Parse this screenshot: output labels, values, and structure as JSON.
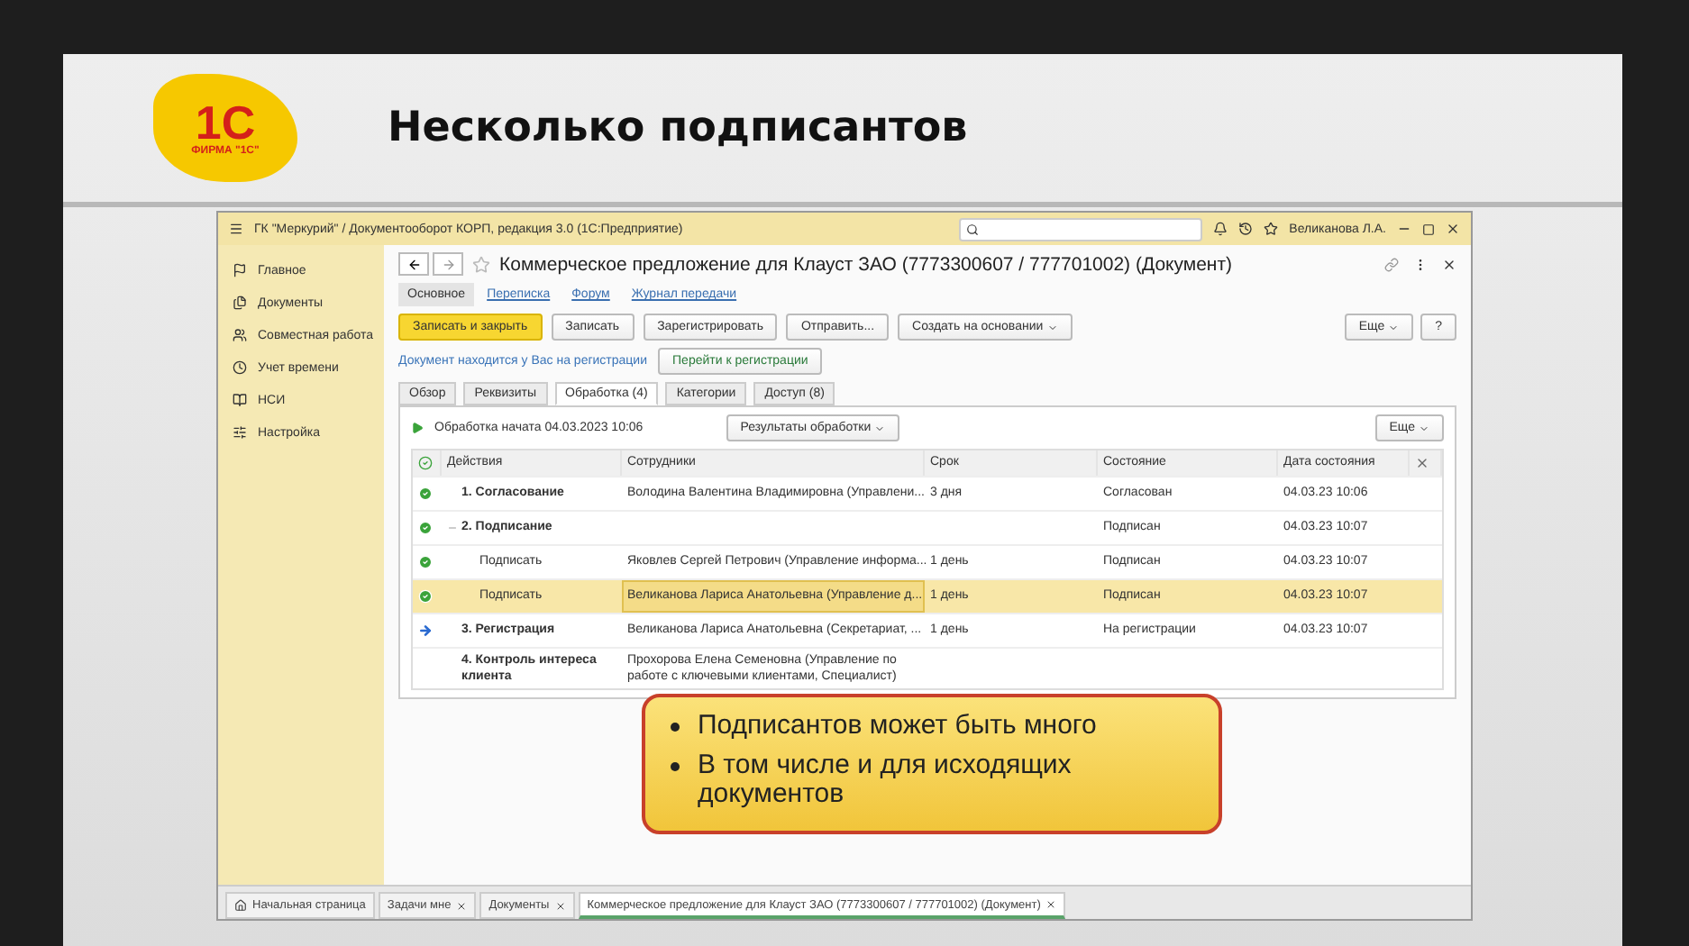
{
  "slide": {
    "title": "Несколько подписантов",
    "logo": {
      "mark": "1С",
      "caption": "ФИРМА \"1С\""
    }
  },
  "window": {
    "title": "ГК \"Меркурий\" / Документооборот КОРП, редакция 3.0 (1С:Предприятие)",
    "user": "Великанова Л.А."
  },
  "sidebar": {
    "items": [
      {
        "label": "Главное",
        "kind": "flag"
      },
      {
        "label": "Документы",
        "kind": "docs"
      },
      {
        "label": "Совместная работа",
        "kind": "people"
      },
      {
        "label": "Учет времени",
        "kind": "clock"
      },
      {
        "label": "НСИ",
        "kind": "book"
      },
      {
        "label": "Настройка",
        "kind": "settings"
      }
    ]
  },
  "document": {
    "title": "Коммерческое предложение для Клауст ЗАО (7773300607 / 777701002) (Документ)",
    "nav": [
      {
        "label": "Основное",
        "selected": true
      },
      {
        "label": "Переписка",
        "selected": false
      },
      {
        "label": "Форум",
        "selected": false
      },
      {
        "label": "Журнал передачи",
        "selected": false
      }
    ],
    "toolbar": [
      {
        "label": "Записать и закрыть",
        "kind": "primary"
      },
      {
        "label": "Записать",
        "kind": "plain"
      },
      {
        "label": "Зарегистрировать",
        "kind": "plain"
      },
      {
        "label": "Отправить...",
        "kind": "plain"
      },
      {
        "label": "Создать на основании",
        "kind": "dropdown"
      }
    ],
    "more": "Еще",
    "help": "?",
    "notice": {
      "text": "Документ находится у Вас на регистрации",
      "button": "Перейти к регистрации"
    },
    "tabs": [
      {
        "label": "Обзор",
        "selected": false
      },
      {
        "label": "Реквизиты",
        "selected": false
      },
      {
        "label": "Обработка (4)",
        "selected": true
      },
      {
        "label": "Категории",
        "selected": false
      },
      {
        "label": "Доступ (8)",
        "selected": false
      }
    ],
    "process": {
      "status": "Обработка начата 04.03.2023 10:06",
      "results": "Результаты обработки",
      "more": "Еще"
    },
    "table": {
      "columns": [
        "Действия",
        "Сотрудники",
        "Срок",
        "Состояние",
        "Дата состояния"
      ],
      "rows": [
        {
          "action": "1. Согласование",
          "employee": "Володина Валентина Владимировна (Управлени...",
          "term": "3 дня",
          "state": "Согласован",
          "date": "04.03.23 10:06",
          "kind": "done",
          "selected": false
        },
        {
          "action": "2. Подписание",
          "state": "Подписан",
          "date": "04.03.23 10:07",
          "kind": "done",
          "selected": false,
          "expanded": true,
          "children": [
            {
              "action": "Подписать",
              "employee": "Яковлев Сергей Петрович (Управление информа...",
              "term": "1 день",
              "state": "Подписан",
              "date": "04.03.23 10:07",
              "kind": "done",
              "selected": false
            },
            {
              "action": "Подписать",
              "employee": "Великанова Лариса Анатольевна (Управление д...",
              "term": "1 день",
              "state": "Подписан",
              "date": "04.03.23 10:07",
              "kind": "done",
              "selected": true
            }
          ]
        },
        {
          "action": "3. Регистрация",
          "employee": "Великанова Лариса Анатольевна (Секретариат, ...",
          "term": "1 день",
          "state": "На регистрации",
          "date": "04.03.23 10:07",
          "kind": "current",
          "selected": false
        },
        {
          "action": "4. Контроль интереса клиента",
          "employee": "Прохорова Елена Семеновна (Управление по работе с ключевыми клиентами, Специалист)",
          "kind": "plain",
          "selected": false
        }
      ]
    }
  },
  "taskbar": [
    {
      "label": "Начальная страница",
      "kind": "home",
      "selected": false
    },
    {
      "label": "Задачи мне",
      "kind": "tab",
      "selected": false
    },
    {
      "label": "Документы",
      "kind": "tab",
      "selected": false
    },
    {
      "label": "Коммерческое предложение для Клауст ЗАО (7773300607 / 777701002) (Документ)",
      "kind": "tab",
      "selected": true
    }
  ],
  "callout": {
    "bullets": [
      "Подписантов может быть много",
      "В том числе и для исходящих документов"
    ]
  }
}
